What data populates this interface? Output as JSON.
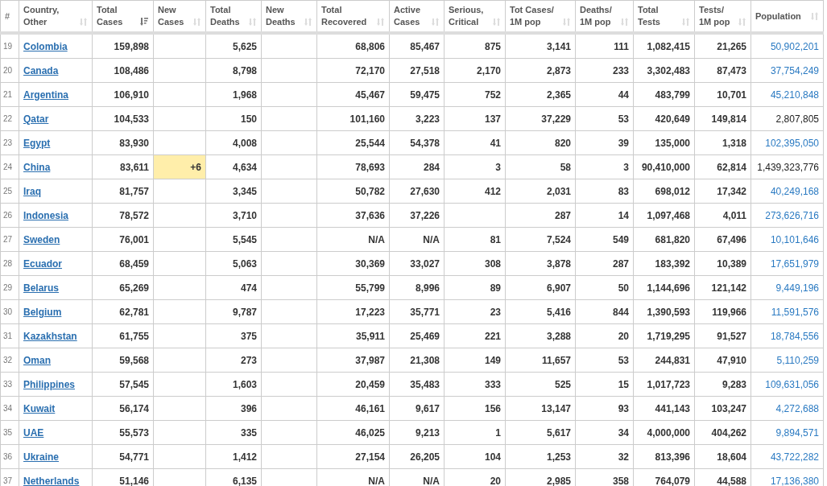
{
  "table": {
    "columns": [
      {
        "label": "#",
        "sorted_desc": false,
        "sortable": false
      },
      {
        "label": "Country,\nOther",
        "sorted_desc": false,
        "sortable": true
      },
      {
        "label": "Total\nCases",
        "sorted_desc": true,
        "sortable": true
      },
      {
        "label": "New\nCases",
        "sorted_desc": false,
        "sortable": true
      },
      {
        "label": "Total\nDeaths",
        "sorted_desc": false,
        "sortable": true
      },
      {
        "label": "New\nDeaths",
        "sorted_desc": false,
        "sortable": true
      },
      {
        "label": "Total\nRecovered",
        "sorted_desc": false,
        "sortable": true
      },
      {
        "label": "Active\nCases",
        "sorted_desc": false,
        "sortable": true
      },
      {
        "label": "Serious,\nCritical",
        "sorted_desc": false,
        "sortable": true
      },
      {
        "label": "Tot Cases/\n1M pop",
        "sorted_desc": false,
        "sortable": true
      },
      {
        "label": "Deaths/\n1M pop",
        "sorted_desc": false,
        "sortable": true
      },
      {
        "label": "Total\nTests",
        "sorted_desc": false,
        "sortable": true
      },
      {
        "label": "Tests/\n1M pop",
        "sorted_desc": false,
        "sortable": true
      },
      {
        "label": "Population",
        "sorted_desc": false,
        "sortable": true
      }
    ],
    "rows": [
      {
        "rank": "19",
        "country": "Colombia",
        "total_cases": "159,898",
        "total_deaths": "5,625",
        "total_recovered": "68,806",
        "active_cases": "85,467",
        "serious_critical": "875",
        "cases_per_1m": "3,141",
        "deaths_per_1m": "111",
        "total_tests": "1,082,415",
        "tests_per_1m": "21,265",
        "population": "50,902,201",
        "population_link": true
      },
      {
        "rank": "20",
        "country": "Canada",
        "total_cases": "108,486",
        "total_deaths": "8,798",
        "total_recovered": "72,170",
        "active_cases": "27,518",
        "serious_critical": "2,170",
        "cases_per_1m": "2,873",
        "deaths_per_1m": "233",
        "total_tests": "3,302,483",
        "tests_per_1m": "87,473",
        "population": "37,754,249",
        "population_link": true
      },
      {
        "rank": "21",
        "country": "Argentina",
        "total_cases": "106,910",
        "total_deaths": "1,968",
        "total_recovered": "45,467",
        "active_cases": "59,475",
        "serious_critical": "752",
        "cases_per_1m": "2,365",
        "deaths_per_1m": "44",
        "total_tests": "483,799",
        "tests_per_1m": "10,701",
        "population": "45,210,848",
        "population_link": true
      },
      {
        "rank": "22",
        "country": "Qatar",
        "total_cases": "104,533",
        "total_deaths": "150",
        "total_recovered": "101,160",
        "active_cases": "3,223",
        "serious_critical": "137",
        "cases_per_1m": "37,229",
        "deaths_per_1m": "53",
        "total_tests": "420,649",
        "tests_per_1m": "149,814",
        "population": "2,807,805",
        "population_link": false
      },
      {
        "rank": "23",
        "country": "Egypt",
        "total_cases": "83,930",
        "total_deaths": "4,008",
        "total_recovered": "25,544",
        "active_cases": "54,378",
        "serious_critical": "41",
        "cases_per_1m": "820",
        "deaths_per_1m": "39",
        "total_tests": "135,000",
        "tests_per_1m": "1,318",
        "population": "102,395,050",
        "population_link": true
      },
      {
        "rank": "24",
        "country": "China",
        "total_cases": "83,611",
        "new_cases": "+6",
        "total_deaths": "4,634",
        "total_recovered": "78,693",
        "active_cases": "284",
        "serious_critical": "3",
        "cases_per_1m": "58",
        "deaths_per_1m": "3",
        "total_tests": "90,410,000",
        "tests_per_1m": "62,814",
        "population": "1,439,323,776",
        "population_link": false
      },
      {
        "rank": "25",
        "country": "Iraq",
        "total_cases": "81,757",
        "total_deaths": "3,345",
        "total_recovered": "50,782",
        "active_cases": "27,630",
        "serious_critical": "412",
        "cases_per_1m": "2,031",
        "deaths_per_1m": "83",
        "total_tests": "698,012",
        "tests_per_1m": "17,342",
        "population": "40,249,168",
        "population_link": true
      },
      {
        "rank": "26",
        "country": "Indonesia",
        "total_cases": "78,572",
        "total_deaths": "3,710",
        "total_recovered": "37,636",
        "active_cases": "37,226",
        "cases_per_1m": "287",
        "deaths_per_1m": "14",
        "total_tests": "1,097,468",
        "tests_per_1m": "4,011",
        "population": "273,626,716",
        "population_link": true
      },
      {
        "rank": "27",
        "country": "Sweden",
        "total_cases": "76,001",
        "total_deaths": "5,545",
        "total_recovered": "N/A",
        "active_cases": "N/A",
        "serious_critical": "81",
        "cases_per_1m": "7,524",
        "deaths_per_1m": "549",
        "total_tests": "681,820",
        "tests_per_1m": "67,496",
        "population": "10,101,646",
        "population_link": true
      },
      {
        "rank": "28",
        "country": "Ecuador",
        "total_cases": "68,459",
        "total_deaths": "5,063",
        "total_recovered": "30,369",
        "active_cases": "33,027",
        "serious_critical": "308",
        "cases_per_1m": "3,878",
        "deaths_per_1m": "287",
        "total_tests": "183,392",
        "tests_per_1m": "10,389",
        "population": "17,651,979",
        "population_link": true
      },
      {
        "rank": "29",
        "country": "Belarus",
        "total_cases": "65,269",
        "total_deaths": "474",
        "total_recovered": "55,799",
        "active_cases": "8,996",
        "serious_critical": "89",
        "cases_per_1m": "6,907",
        "deaths_per_1m": "50",
        "total_tests": "1,144,696",
        "tests_per_1m": "121,142",
        "population": "9,449,196",
        "population_link": true
      },
      {
        "rank": "30",
        "country": "Belgium",
        "total_cases": "62,781",
        "total_deaths": "9,787",
        "total_recovered": "17,223",
        "active_cases": "35,771",
        "serious_critical": "23",
        "cases_per_1m": "5,416",
        "deaths_per_1m": "844",
        "total_tests": "1,390,593",
        "tests_per_1m": "119,966",
        "population": "11,591,576",
        "population_link": true
      },
      {
        "rank": "31",
        "country": "Kazakhstan",
        "total_cases": "61,755",
        "total_deaths": "375",
        "total_recovered": "35,911",
        "active_cases": "25,469",
        "serious_critical": "221",
        "cases_per_1m": "3,288",
        "deaths_per_1m": "20",
        "total_tests": "1,719,295",
        "tests_per_1m": "91,527",
        "population": "18,784,556",
        "population_link": true
      },
      {
        "rank": "32",
        "country": "Oman",
        "total_cases": "59,568",
        "total_deaths": "273",
        "total_recovered": "37,987",
        "active_cases": "21,308",
        "serious_critical": "149",
        "cases_per_1m": "11,657",
        "deaths_per_1m": "53",
        "total_tests": "244,831",
        "tests_per_1m": "47,910",
        "population": "5,110,259",
        "population_link": true
      },
      {
        "rank": "33",
        "country": "Philippines",
        "total_cases": "57,545",
        "total_deaths": "1,603",
        "total_recovered": "20,459",
        "active_cases": "35,483",
        "serious_critical": "333",
        "cases_per_1m": "525",
        "deaths_per_1m": "15",
        "total_tests": "1,017,723",
        "tests_per_1m": "9,283",
        "population": "109,631,056",
        "population_link": true
      },
      {
        "rank": "34",
        "country": "Kuwait",
        "total_cases": "56,174",
        "total_deaths": "396",
        "total_recovered": "46,161",
        "active_cases": "9,617",
        "serious_critical": "156",
        "cases_per_1m": "13,147",
        "deaths_per_1m": "93",
        "total_tests": "441,143",
        "tests_per_1m": "103,247",
        "population": "4,272,688",
        "population_link": true
      },
      {
        "rank": "35",
        "country": "UAE",
        "total_cases": "55,573",
        "total_deaths": "335",
        "total_recovered": "46,025",
        "active_cases": "9,213",
        "serious_critical": "1",
        "cases_per_1m": "5,617",
        "deaths_per_1m": "34",
        "total_tests": "4,000,000",
        "tests_per_1m": "404,262",
        "population": "9,894,571",
        "population_link": true
      },
      {
        "rank": "36",
        "country": "Ukraine",
        "total_cases": "54,771",
        "total_deaths": "1,412",
        "total_recovered": "27,154",
        "active_cases": "26,205",
        "serious_critical": "104",
        "cases_per_1m": "1,253",
        "deaths_per_1m": "32",
        "total_tests": "813,396",
        "tests_per_1m": "18,604",
        "population": "43,722,282",
        "population_link": true
      },
      {
        "rank": "37",
        "country": "Netherlands",
        "total_cases": "51,146",
        "total_deaths": "6,135",
        "total_recovered": "N/A",
        "active_cases": "N/A",
        "serious_critical": "20",
        "cases_per_1m": "2,985",
        "deaths_per_1m": "358",
        "total_tests": "764,079",
        "tests_per_1m": "44,588",
        "population": "17,136,380",
        "population_link": true
      }
    ]
  }
}
